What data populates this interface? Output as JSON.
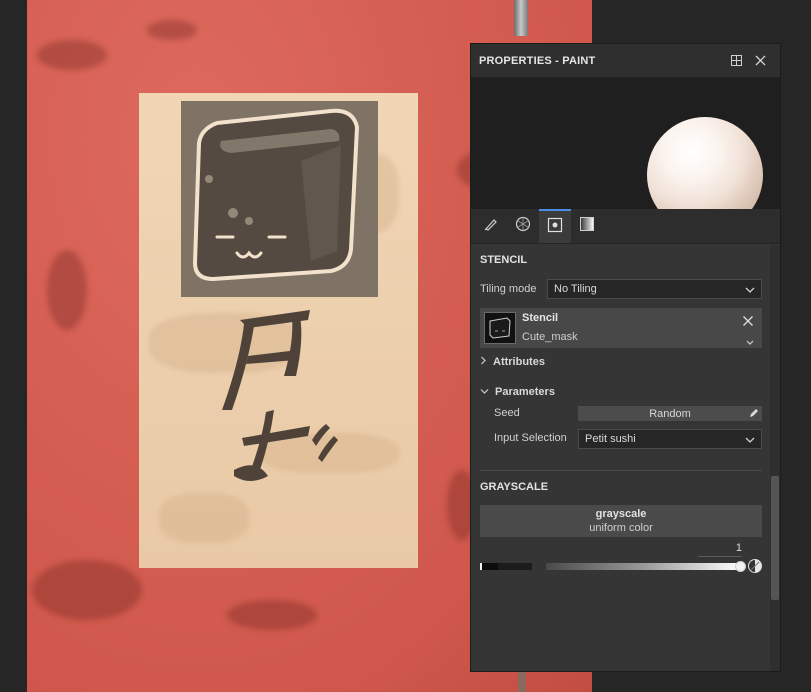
{
  "panel": {
    "title": "PROPERTIES - PAINT",
    "header_icons": [
      "dock-icon",
      "close-icon"
    ],
    "tabs": [
      {
        "icon": "brush-icon",
        "active": false
      },
      {
        "icon": "material-icon",
        "active": false
      },
      {
        "icon": "stencil-icon",
        "active": true
      },
      {
        "icon": "gradient-icon",
        "active": false
      }
    ],
    "accent_color": "#4a90e2"
  },
  "stencil_section": {
    "title": "STENCIL",
    "tiling_label": "Tiling mode",
    "tiling_value": "No Tiling",
    "resource_name": "Stencil",
    "resource_mask": "Cute_mask",
    "attributes_label": "Attributes",
    "parameters_label": "Parameters",
    "seed_label": "Seed",
    "seed_value": "Random",
    "input_selection_label": "Input Selection",
    "input_selection_value": "Petit sushi"
  },
  "grayscale_section": {
    "title": "GRAYSCALE",
    "resource_name": "grayscale",
    "resource_type": "uniform color",
    "value": "1",
    "value_fraction": 1.0
  }
}
